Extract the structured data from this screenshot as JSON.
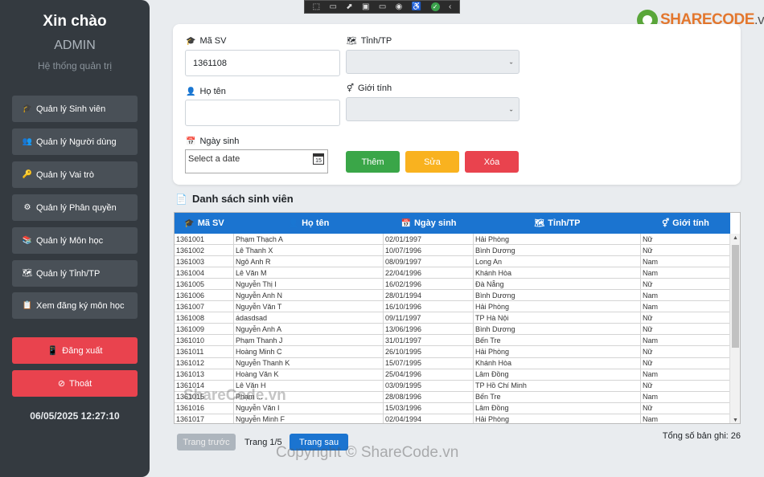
{
  "sidebar": {
    "greeting": "Xin chào",
    "user": "ADMIN",
    "subtitle": "Hệ thống quản trị",
    "menu": [
      {
        "label": "Quản lý Sinh viên",
        "icon": "graduation-cap-icon",
        "glyph": "🎓"
      },
      {
        "label": "Quản lý Người dùng",
        "icon": "users-icon",
        "glyph": "👥"
      },
      {
        "label": "Quản lý Vai trò",
        "icon": "key-icon",
        "glyph": "🔑"
      },
      {
        "label": "Quản lý Phân quyền",
        "icon": "gear-icon",
        "glyph": "⚙"
      },
      {
        "label": "Quản lý Môn học",
        "icon": "books-icon",
        "glyph": "📚"
      },
      {
        "label": "Quản lý Tỉnh/TP",
        "icon": "map-icon",
        "glyph": "🗺"
      },
      {
        "label": "Xem đăng ký môn học",
        "icon": "clipboard-icon",
        "glyph": "📋"
      }
    ],
    "logout": "Đăng xuất",
    "exit": "Thoát",
    "datetime": "06/05/2025 12:27:10"
  },
  "logo": {
    "part1": "SHARE",
    "part2": "CODE",
    "part3": ".vn"
  },
  "form": {
    "student_id_label": "Mã SV",
    "student_id_value": "1361108",
    "name_label": "Họ tên",
    "name_value": "",
    "dob_label": "Ngày sinh",
    "dob_placeholder": "Select a date",
    "dob_calendar_day": "15",
    "province_label": "Tỉnh/TP",
    "province_value": "",
    "gender_label": "Giới tính",
    "gender_value": "",
    "add_button": "Thêm",
    "edit_button": "Sửa",
    "delete_button": "Xóa"
  },
  "colors": {
    "add": "#3aa648",
    "edit": "#f9b21f",
    "delete": "#e9434e",
    "header": "#1b74d0"
  },
  "list": {
    "title": "Danh sách sinh viên",
    "columns": [
      "Mã SV",
      "Họ tên",
      "Ngày sinh",
      "Tỉnh/TP",
      "Giới tính"
    ],
    "rows": [
      [
        "1361001",
        "Phạm Thạch A",
        "02/01/1997",
        "Hải Phòng",
        "Nữ"
      ],
      [
        "1361002",
        "Lê Thanh X",
        "10/07/1996",
        "Bình Dương",
        "Nữ"
      ],
      [
        "1361003",
        "Ngô Anh R",
        "08/09/1997",
        "Long An",
        "Nam"
      ],
      [
        "1361004",
        "Lê Văn M",
        "22/04/1996",
        "Khánh Hòa",
        "Nam"
      ],
      [
        "1361005",
        "Nguyễn Thị I",
        "16/02/1996",
        "Đà Nẵng",
        "Nữ"
      ],
      [
        "1361006",
        "Nguyễn Anh N",
        "28/01/1994",
        "Bình Dương",
        "Nam"
      ],
      [
        "1361007",
        "Nguyễn Văn T",
        "16/10/1996",
        "Hải Phòng",
        "Nam"
      ],
      [
        "1361008",
        "ádasdsad",
        "09/11/1997",
        "TP Hà Nội",
        "Nữ"
      ],
      [
        "1361009",
        "Nguyễn Anh A",
        "13/06/1996",
        "Bình Dương",
        "Nữ"
      ],
      [
        "1361010",
        "Phạm Thanh J",
        "31/01/1997",
        "Bến Tre",
        "Nam"
      ],
      [
        "1361011",
        "Hoàng Minh C",
        "26/10/1995",
        "Hải Phòng",
        "Nữ"
      ],
      [
        "1361012",
        "Nguyễn Thanh K",
        "15/07/1995",
        "Khánh Hòa",
        "Nữ"
      ],
      [
        "1361013",
        "Hoàng Văn K",
        "25/04/1996",
        "Lâm Đồng",
        "Nam"
      ],
      [
        "1361014",
        "Lê Văn H",
        "03/09/1995",
        "TP Hồ Chí Minh",
        "Nữ"
      ],
      [
        "1361015",
        "Phạm ...",
        "28/08/1996",
        "Bến Tre",
        "Nam"
      ],
      [
        "1361016",
        "Nguyễn Văn I",
        "15/03/1996",
        "Lâm Đồng",
        "Nữ"
      ],
      [
        "1361017",
        "Nguyễn Minh F",
        "02/04/1994",
        "Hải Phòng",
        "Nam"
      ]
    ]
  },
  "pagination": {
    "prev": "Trang trước",
    "info": "Trang 1/5",
    "next": "Trang sau",
    "total": "Tổng số bản ghi: 26"
  },
  "watermarks": {
    "table": "ShareCode.vn",
    "footer": "Copyright © ShareCode.vn"
  }
}
